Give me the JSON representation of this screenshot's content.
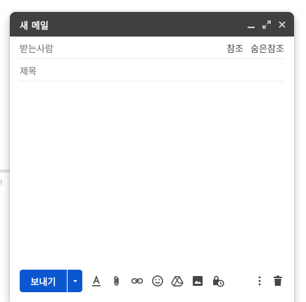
{
  "window": {
    "title": "새 메일"
  },
  "header_icons": [
    "minimize-icon",
    "expand-icon",
    "close-icon"
  ],
  "to": {
    "label": "받는사람",
    "cc": "참조",
    "bcc": "숨은참조"
  },
  "subject": {
    "placeholder": "제목"
  },
  "toolbar": {
    "send_label": "보내기",
    "icons": [
      "send-options-icon",
      "text-format-icon",
      "attach-icon",
      "link-icon",
      "emoji-icon",
      "drive-icon",
      "image-icon",
      "confidential-mode-icon",
      "more-options-icon",
      "discard-draft-icon"
    ]
  },
  "colors": {
    "header": "#404040",
    "send_button": "#0b57d0",
    "icon": "#444746"
  }
}
